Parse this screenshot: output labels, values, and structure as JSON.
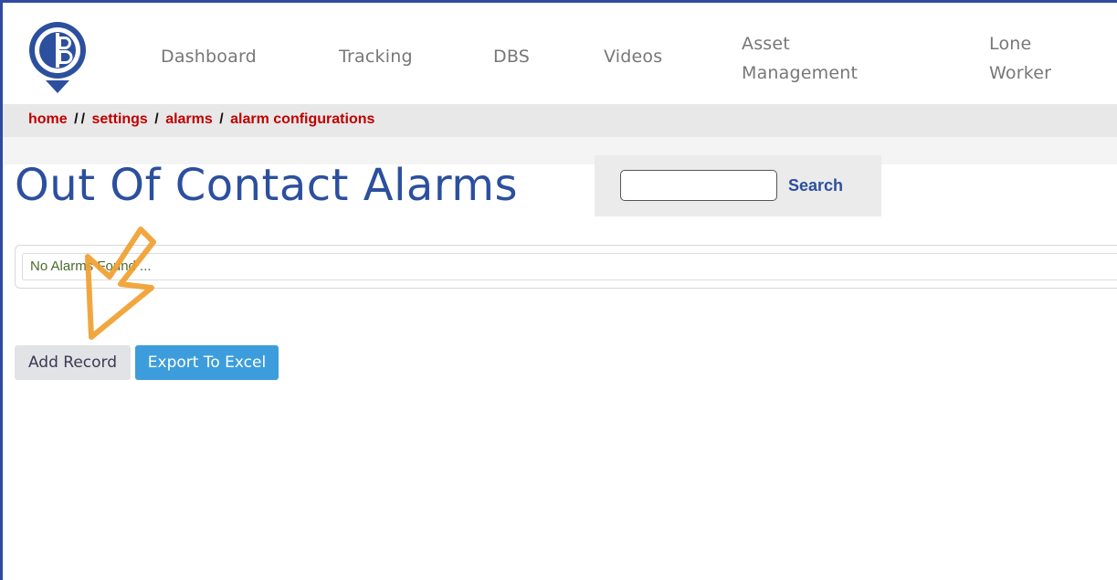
{
  "nav": {
    "items": [
      {
        "label": "Dashboard"
      },
      {
        "label": "Tracking"
      },
      {
        "label": "DBS"
      },
      {
        "label": "Videos"
      },
      {
        "label_line1": "Asset",
        "label_line2": "Management"
      },
      {
        "label_line1": "Lone",
        "label_line2": "Worker"
      }
    ]
  },
  "breadcrumb": {
    "home": "home",
    "sep": "/",
    "settings": "settings",
    "alarms": "alarms",
    "current": "alarm configurations"
  },
  "page": {
    "title": "Out Of Contact Alarms"
  },
  "search": {
    "value": "",
    "button_label": "Search"
  },
  "results": {
    "empty_message": "No Alarms Found ..."
  },
  "actions": {
    "add_label": "Add Record",
    "export_label": "Export To Excel"
  },
  "colors": {
    "brand_blue": "#2c4f9e",
    "breadcrumb_red": "#c00000",
    "export_blue": "#3d9ddc",
    "annotation_orange": "#f0a030"
  },
  "icons": {
    "logo": "cb-location-pin-logo",
    "annotation": "annotation-arrow-icon"
  }
}
